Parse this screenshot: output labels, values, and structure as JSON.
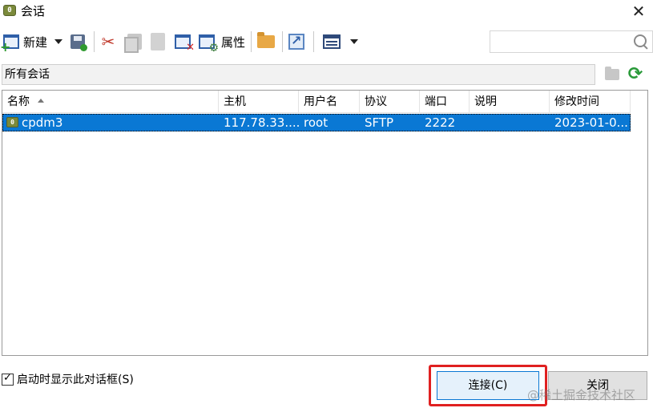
{
  "window": {
    "title": "会话",
    "app_icon_text": "0"
  },
  "toolbar": {
    "new_label": "新建",
    "properties_label": "属性"
  },
  "search": {
    "value": "",
    "placeholder": ""
  },
  "folder_bar": {
    "current_folder": "所有会话"
  },
  "session_table": {
    "columns": [
      "名称",
      "主机",
      "用户名",
      "协议",
      "端口",
      "说明",
      "修改时间"
    ],
    "sorted_column": "名称",
    "rows": [
      {
        "name": "cpdm3",
        "host": "117.78.33....",
        "user": "root",
        "protocol": "SFTP",
        "port": "2222",
        "description": "",
        "modified": "2023-01-0...",
        "selected": true
      }
    ]
  },
  "footer": {
    "show_on_startup_label": "启动时显示此对话框(S)",
    "show_on_startup_checked": true,
    "connect_label": "连接(C)",
    "close_label": "关闭",
    "watermark": "@稀土掘金技术社区"
  },
  "colors": {
    "selection": "#0a78d4",
    "highlight": "#e02020",
    "refresh": "#2a9a3a"
  }
}
